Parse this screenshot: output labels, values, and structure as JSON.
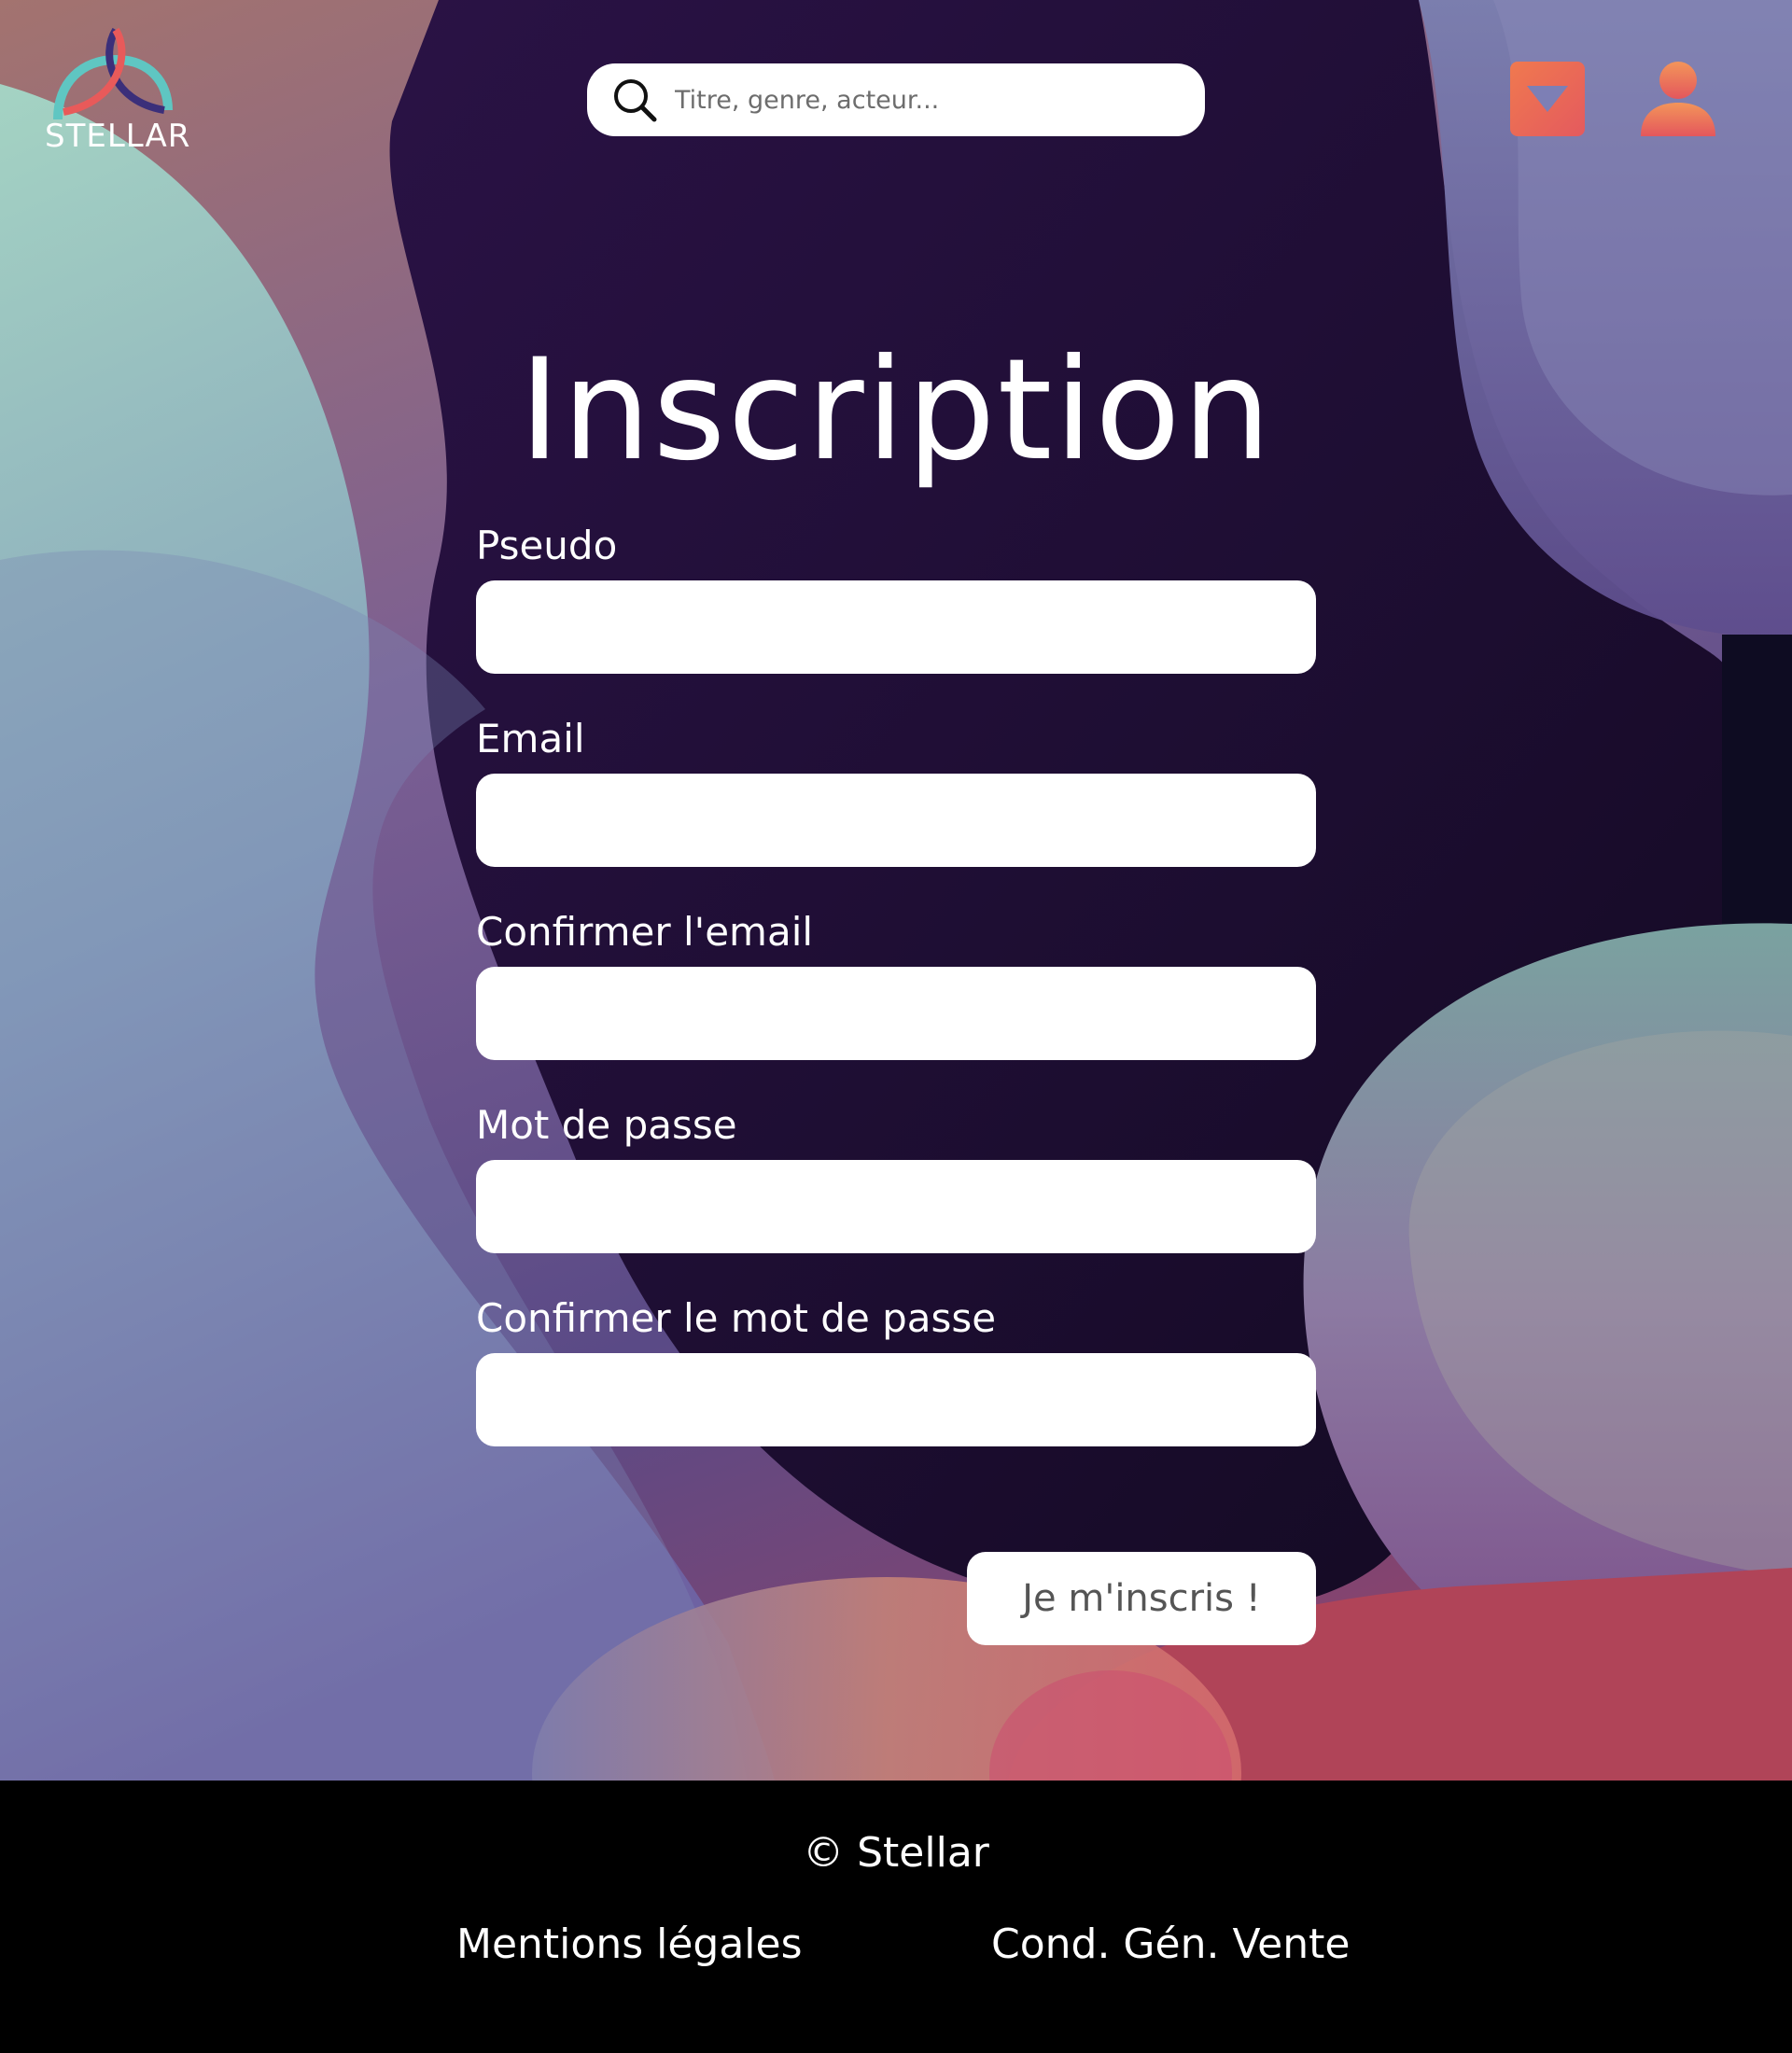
{
  "header": {
    "logo_text": "STELLAR",
    "search_placeholder": "Titre, genre, acteur..."
  },
  "form": {
    "title": "Inscription",
    "fields": [
      {
        "label": "Pseudo",
        "value": ""
      },
      {
        "label": "Email",
        "value": ""
      },
      {
        "label": "Confirmer l'email",
        "value": ""
      },
      {
        "label": "Mot de passe",
        "value": ""
      },
      {
        "label": "Confirmer le mot de passe",
        "value": ""
      }
    ],
    "submit_label": "Je m'inscris !"
  },
  "footer": {
    "copyright": "© Stellar",
    "legal_label": "Mentions légales",
    "terms_label": "Cond. Gén. Vente"
  },
  "colors": {
    "dark_bg": "#1f0f33",
    "accent": "#ef7350",
    "footer_bg": "#000000"
  },
  "icons": {
    "search": "search-icon",
    "cart": "cart-dropdown-icon",
    "user": "user-icon"
  }
}
